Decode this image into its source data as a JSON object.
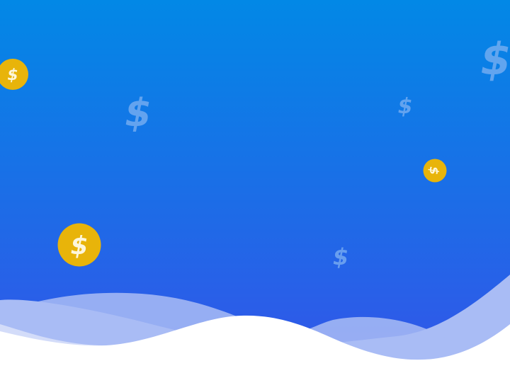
{
  "colors": {
    "gradient_top": "#0288e6",
    "gradient_bottom": "#3355e8",
    "coin_fill": "#e8b40a",
    "coin_symbol": "#fdf6dc",
    "floating_symbol": "#7fb2f2",
    "wave_back": "#a9bcf5",
    "wave_mid": "#d3dcf9",
    "wave_front": "#ffffff"
  },
  "symbols": {
    "currency": "$"
  },
  "icons": {
    "coin": "dollar-coin-icon",
    "floating": "dollar-sign-icon"
  }
}
